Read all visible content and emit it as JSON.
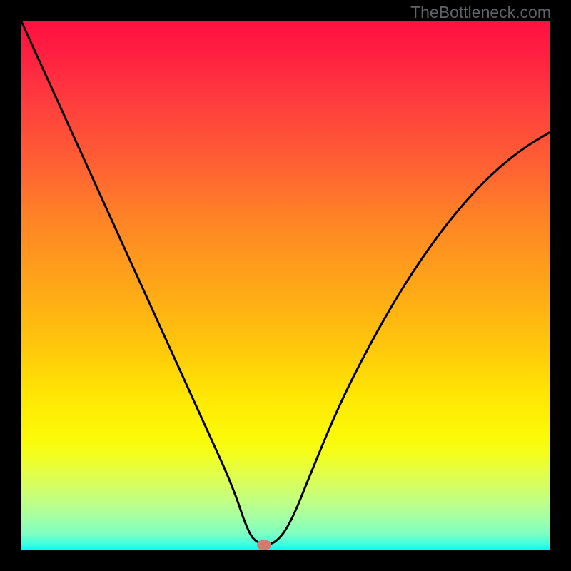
{
  "watermark": "TheBottleneck.com",
  "chart_data": {
    "type": "line",
    "title": "",
    "xlabel": "",
    "ylabel": "",
    "xlim": [
      0,
      100
    ],
    "ylim": [
      0,
      100
    ],
    "grid": false,
    "gradient_background": {
      "axis": "vertical",
      "top_color_meaning": "high bottleneck (red)",
      "bottom_color_meaning": "no bottleneck (green)",
      "stops": [
        {
          "pos": 0.0,
          "color": "#ff113f"
        },
        {
          "pos": 0.5,
          "color": "#ffa618"
        },
        {
          "pos": 0.79,
          "color": "#fbfa08"
        },
        {
          "pos": 1.0,
          "color": "#00fff6"
        }
      ]
    },
    "series": [
      {
        "name": "bottleneck-curve",
        "color": "#000000",
        "x": [
          0,
          5,
          10,
          15,
          20,
          25,
          30,
          35,
          40,
          43,
          45,
          48,
          51,
          55,
          60,
          65,
          70,
          75,
          80,
          85,
          90,
          95,
          100
        ],
        "y": [
          100,
          89,
          78,
          67,
          56,
          45,
          34,
          23,
          12,
          3,
          1,
          1,
          5,
          15,
          27,
          37,
          46,
          54,
          61,
          67,
          72,
          76,
          79
        ]
      }
    ],
    "marker": {
      "name": "optimal-point",
      "x": 46,
      "y": 1,
      "color": "#cf7c6f"
    }
  }
}
